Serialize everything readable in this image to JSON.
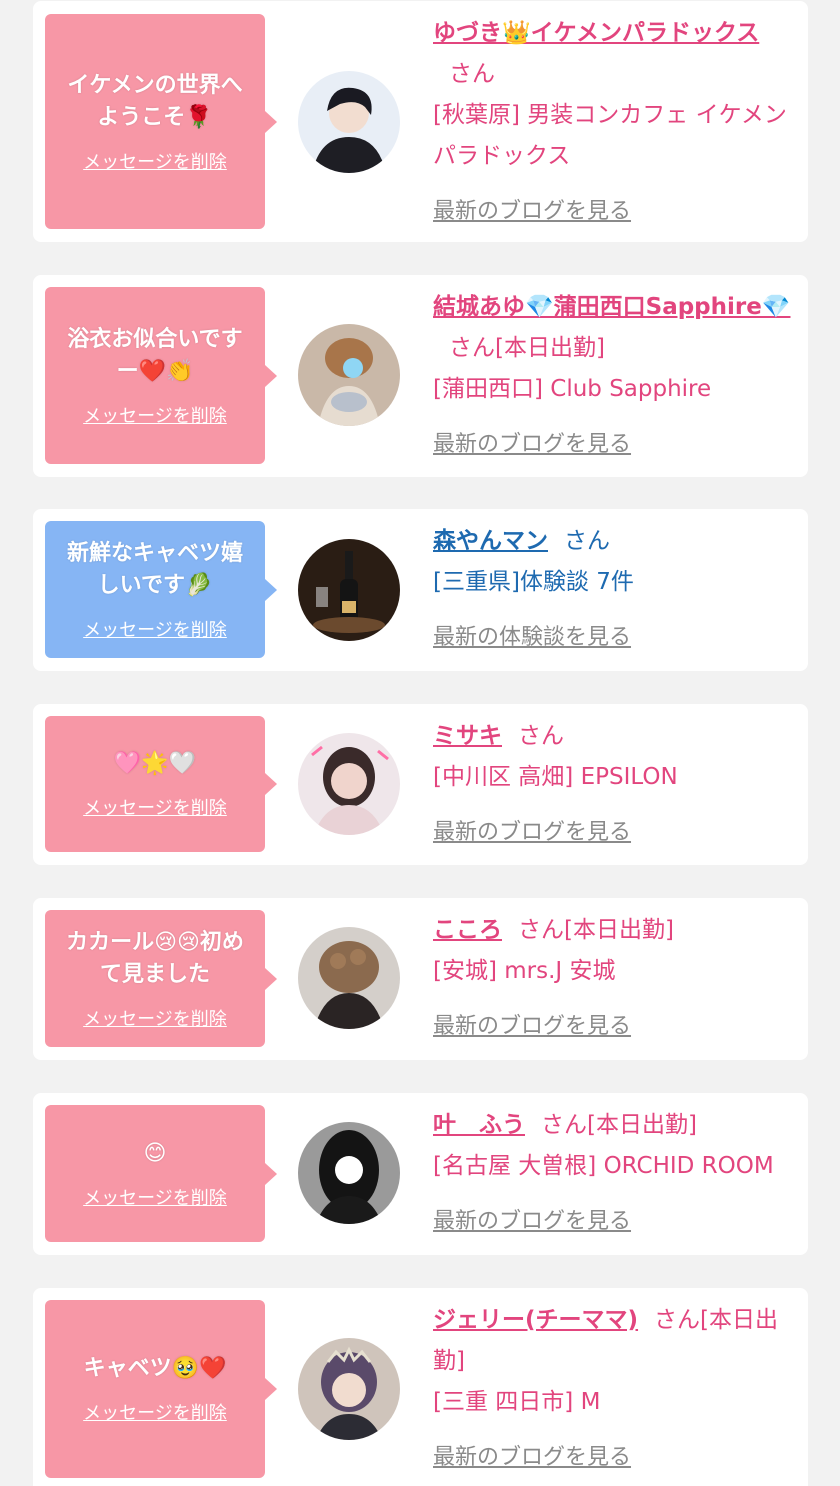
{
  "delete_label": "メッセージを削除",
  "san": "さん",
  "cards": [
    {
      "message": "イケメンの世界へようこそ🌹",
      "name": "ゆづき👑イケメンパラドックス",
      "suffix": "",
      "shop": "[秋葉原] 男装コンカフェ イケメンパラドックス",
      "link": "最新のブログを見る"
    },
    {
      "message": "浴衣お似合いですー❤️👏",
      "name": "結城あゆ💎蒲田西口Sapphire💎",
      "suffix": "[本日出勤]",
      "shop": "[蒲田西口] Club Sapphire",
      "link": "最新のブログを見る"
    },
    {
      "message": "新鮮なキャベツ嬉しいです🥬",
      "name": "森やんマン",
      "suffix": "",
      "shop": "[三重県]体験談 7件",
      "link": "最新の体験談を見る"
    },
    {
      "message": "🩷🌟🤍",
      "name": "ミサキ",
      "suffix": "",
      "shop": "[中川区 高畑] EPSILON",
      "link": "最新のブログを見る"
    },
    {
      "message": "カカール😢😢初めて見ました",
      "name": "こころ",
      "suffix": "[本日出勤]",
      "shop": "[安城] mrs.J 安城",
      "link": "最新のブログを見る"
    },
    {
      "message": "😊",
      "name": "叶　ふう",
      "suffix": "[本日出勤]",
      "shop": "[名古屋 大曽根] ORCHID ROOM",
      "link": "最新のブログを見る"
    },
    {
      "message": "キャベツ🥹❤️",
      "name": "ジェリー(チーママ)",
      "suffix": "[本日出勤]",
      "shop": "[三重 四日市] M",
      "link": "最新のブログを見る"
    }
  ]
}
